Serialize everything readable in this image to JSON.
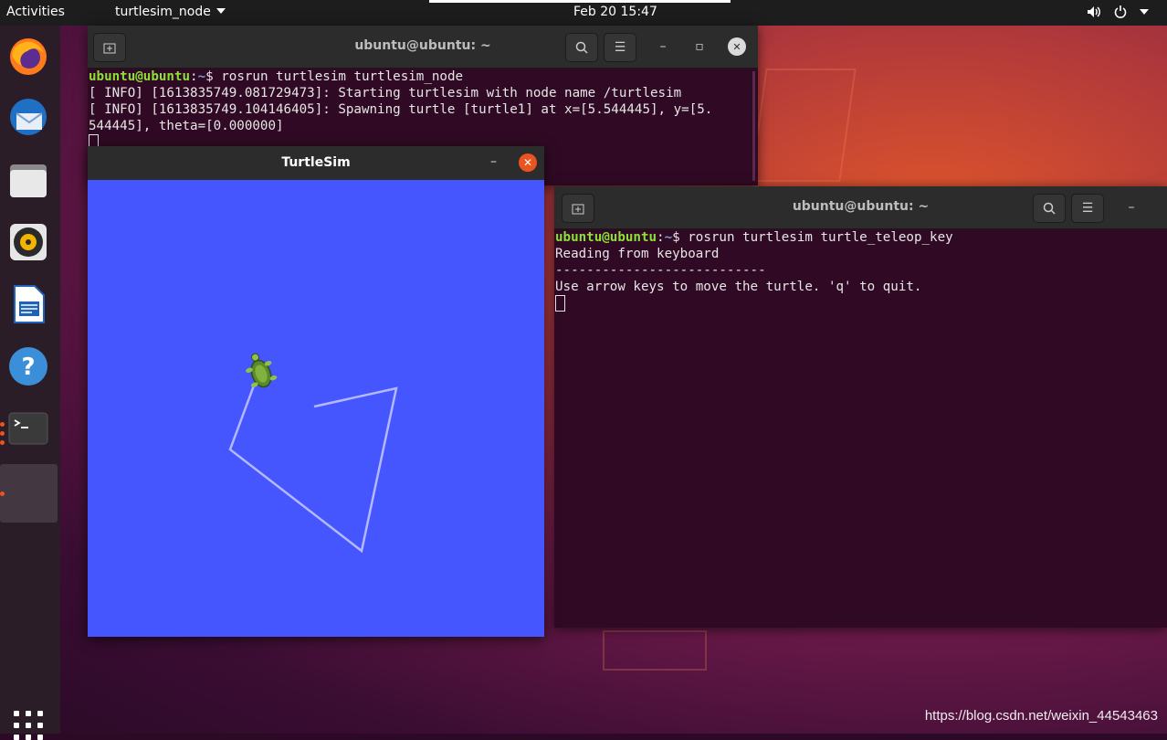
{
  "topbar": {
    "activities": "Activities",
    "app_menu": "turtlesim_node",
    "clock": "Feb 20  15:47"
  },
  "dock": {
    "items": [
      "firefox-icon",
      "thunderbird-icon",
      "files-icon",
      "rhythmbox-icon",
      "libreoffice-writer-icon",
      "help-icon",
      "terminal-icon",
      "turtlesim-app-icon"
    ],
    "show_apps": "show-applications-icon"
  },
  "terminal1": {
    "title": "ubuntu@ubuntu: ~",
    "prompt_user": "ubuntu@ubuntu",
    "prompt_sep": ":",
    "prompt_path": "~",
    "prompt_end": "$ ",
    "command": "rosrun turtlesim turtlesim_node",
    "lines": [
      "[ INFO] [1613835749.081729473]: Starting turtlesim with node name /turtlesim",
      "[ INFO] [1613835749.104146405]: Spawning turtle [turtle1] at x=[5.544445], y=[5.",
      "544445], theta=[0.000000]"
    ]
  },
  "terminal2": {
    "title": "ubuntu@ubuntu: ~",
    "prompt_user": "ubuntu@ubuntu",
    "prompt_sep": ":",
    "prompt_path": "~",
    "prompt_end": "$ ",
    "command": "rosrun turtlesim turtle_teleop_key",
    "lines": [
      "Reading from keyboard",
      "---------------------------",
      "Use arrow keys to move the turtle. 'q' to quit."
    ]
  },
  "turtlesim": {
    "title": "TurtleSim",
    "background": "#4556ff",
    "pen_color": "#b3b8ff"
  },
  "watermark": "https://blog.csdn.net/weixin_44543463",
  "colors": {
    "accent": "#e95420",
    "terminal_bg": "#300a24",
    "prompt_user": "#8ae234",
    "prompt_path": "#729fcf"
  }
}
